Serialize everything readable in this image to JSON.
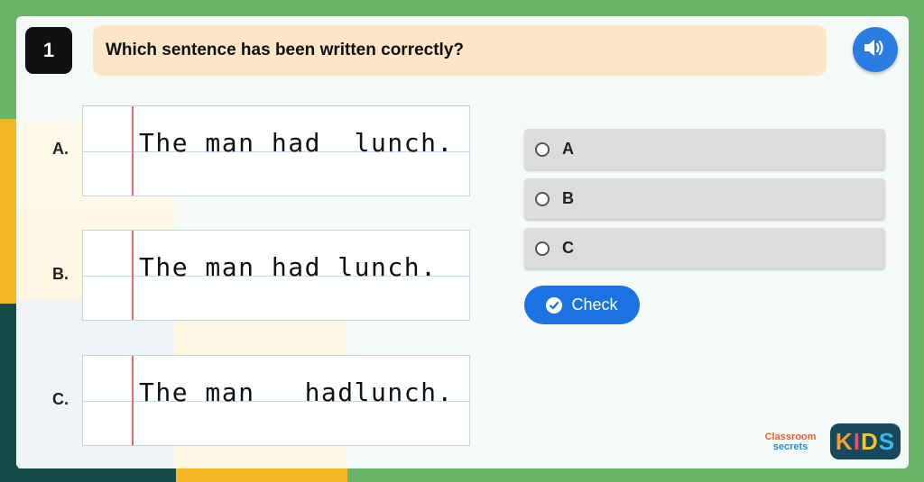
{
  "question": {
    "number": "1",
    "text": "Which sentence has been written correctly?"
  },
  "audio": {
    "icon": "speaker-icon"
  },
  "options": [
    {
      "letter": "A.",
      "sentence": "The man had  lunch."
    },
    {
      "letter": "B.",
      "sentence": "The man had lunch."
    },
    {
      "letter": "C.",
      "sentence": "The man   hadlunch."
    }
  ],
  "answers": [
    {
      "label": "A"
    },
    {
      "label": "B"
    },
    {
      "label": "C"
    }
  ],
  "check": {
    "label": "Check",
    "icon": "check-circle-icon"
  },
  "branding": {
    "classroom": "Classroom",
    "secrets": "secrets",
    "kids": [
      "K",
      "I",
      "D",
      "S"
    ],
    "kids_colors": [
      "#f39c3a",
      "#e94e77",
      "#f4c430",
      "#3fb6e8"
    ]
  },
  "colors": {
    "outer_green": "#6ab56a",
    "accent_blue": "#1a73e0",
    "question_bg": "#fde5c8"
  }
}
